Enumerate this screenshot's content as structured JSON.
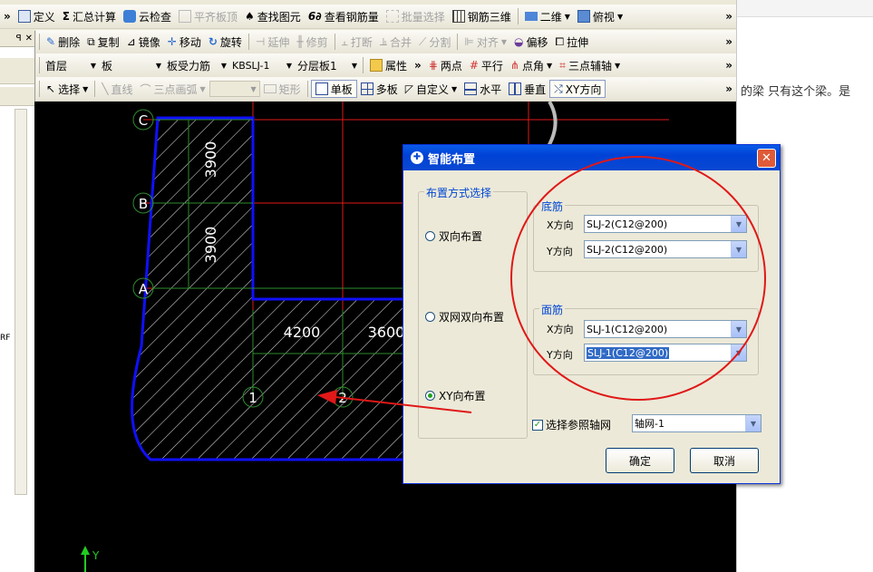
{
  "toolbar1": {
    "define": "定义",
    "sum_calc": "汇总计算",
    "cloud_check": "云检查",
    "flat_top": "平齐板顶",
    "find_element": "查找图元",
    "view_rebar_qty": "查看钢筋量",
    "batch_select": "批量选择",
    "rebar_3d": "钢筋三维",
    "view_2d": "二维",
    "view_mode": "俯视"
  },
  "toolbar2": {
    "delete": "删除",
    "copy": "复制",
    "mirror": "镜像",
    "move": "移动",
    "rotate": "旋转",
    "extend": "延伸",
    "trim": "修剪",
    "break": "打断",
    "merge": "合并",
    "split": "分割",
    "align": "对齐",
    "offset": "偏移",
    "stretch": "拉伸"
  },
  "toolbar3": {
    "floor": "首层",
    "category": "板",
    "element_type": "板受力筋",
    "element_name": "KBSLJ-1",
    "layer": "分层板1",
    "properties": "属性",
    "two_points": "两点",
    "parallel": "平行",
    "point_angle": "点角",
    "three_point_axis": "三点辅轴"
  },
  "toolbar4": {
    "select": "选择",
    "line": "直线",
    "arc": "三点画弧",
    "rect": "矩形",
    "single_slab": "单板",
    "multi_slab": "多板",
    "custom": "自定义",
    "horizontal": "水平",
    "vertical": "垂直",
    "xy_direction": "XY方向"
  },
  "left_panel": {
    "pin": "ꟼ",
    "close": "✕",
    "rf": "RF"
  },
  "right_panel": {
    "text": "的梁 只有这个梁。是"
  },
  "cad": {
    "axis_labels": [
      "C",
      "B",
      "A",
      "1",
      "2"
    ],
    "dimensions": [
      "3900",
      "3900",
      "4200",
      "3600"
    ],
    "y_axis": "Y"
  },
  "dialog": {
    "title": "智能布置",
    "close": "✕",
    "mode_group": "布置方式选择",
    "modes": [
      "双向布置",
      "双网双向布置",
      "XY向布置"
    ],
    "selected_mode": 2,
    "bottom_group": "底筋",
    "top_group": "面筋",
    "x_dir": "X方向",
    "y_dir": "Y方向",
    "bottom_x": "SLJ-2(C12@200)",
    "bottom_y": "SLJ-2(C12@200)",
    "top_x": "SLJ-1(C12@200)",
    "top_y": "SLJ-1(C12@200)",
    "axis_check_label": "选择参照轴网",
    "axis_checked": "✓",
    "axis_value": "轴网-1",
    "ok": "确定",
    "cancel": "取消"
  },
  "colors": {
    "annotation_red": "#e01818",
    "slab_blue": "#1010ff",
    "grid_red": "#e01818",
    "grid_green": "#2e8b2e"
  }
}
